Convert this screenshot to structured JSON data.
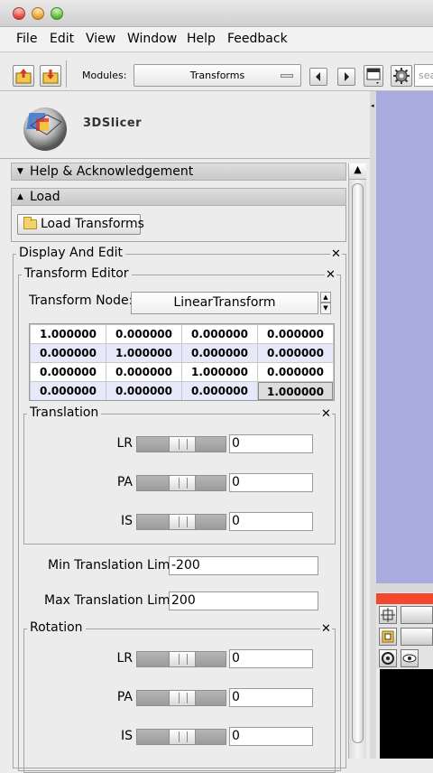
{
  "menu": [
    "File",
    "Edit",
    "View",
    "Window",
    "Help",
    "Feedback"
  ],
  "toolbar": {
    "modules_label": "Modules:",
    "modules_value": "Transforms",
    "search_placeholder": "sea"
  },
  "logo": {
    "text": "3DSlicer"
  },
  "sections": {
    "help": "Help & Acknowledgement",
    "load": "Load",
    "load_button": "Load Transforms",
    "display_edit": "Display And Edit",
    "transform_editor": "Transform Editor",
    "transform_node_label": "Transform Node:",
    "transform_node_value": "LinearTransform"
  },
  "matrix": [
    [
      "1.000000",
      "0.000000",
      "0.000000",
      "0.000000"
    ],
    [
      "0.000000",
      "1.000000",
      "0.000000",
      "0.000000"
    ],
    [
      "0.000000",
      "0.000000",
      "1.000000",
      "0.000000"
    ],
    [
      "0.000000",
      "0.000000",
      "0.000000",
      "1.000000"
    ]
  ],
  "translation": {
    "title": "Translation",
    "lr_label": "LR",
    "lr_value": "0",
    "pa_label": "PA",
    "pa_value": "0",
    "is_label": "IS",
    "is_value": "0",
    "min_label": "Min Translation Limit",
    "min_value": "-200",
    "max_label": "Max Translation Limit",
    "max_value": "200"
  },
  "rotation": {
    "title": "Rotation",
    "lr_label": "LR",
    "lr_value": "0",
    "pa_label": "PA",
    "pa_value": "0",
    "is_label": "IS",
    "is_value": "0"
  },
  "icons": {
    "close": "✕",
    "expand": "▼",
    "collapse": "▲",
    "scroll_up": "▲"
  },
  "colors": {
    "viewer_blue": "#a9aade",
    "red_slice": "#f3472e",
    "matrix_alt_row": "#e7e9fb"
  }
}
